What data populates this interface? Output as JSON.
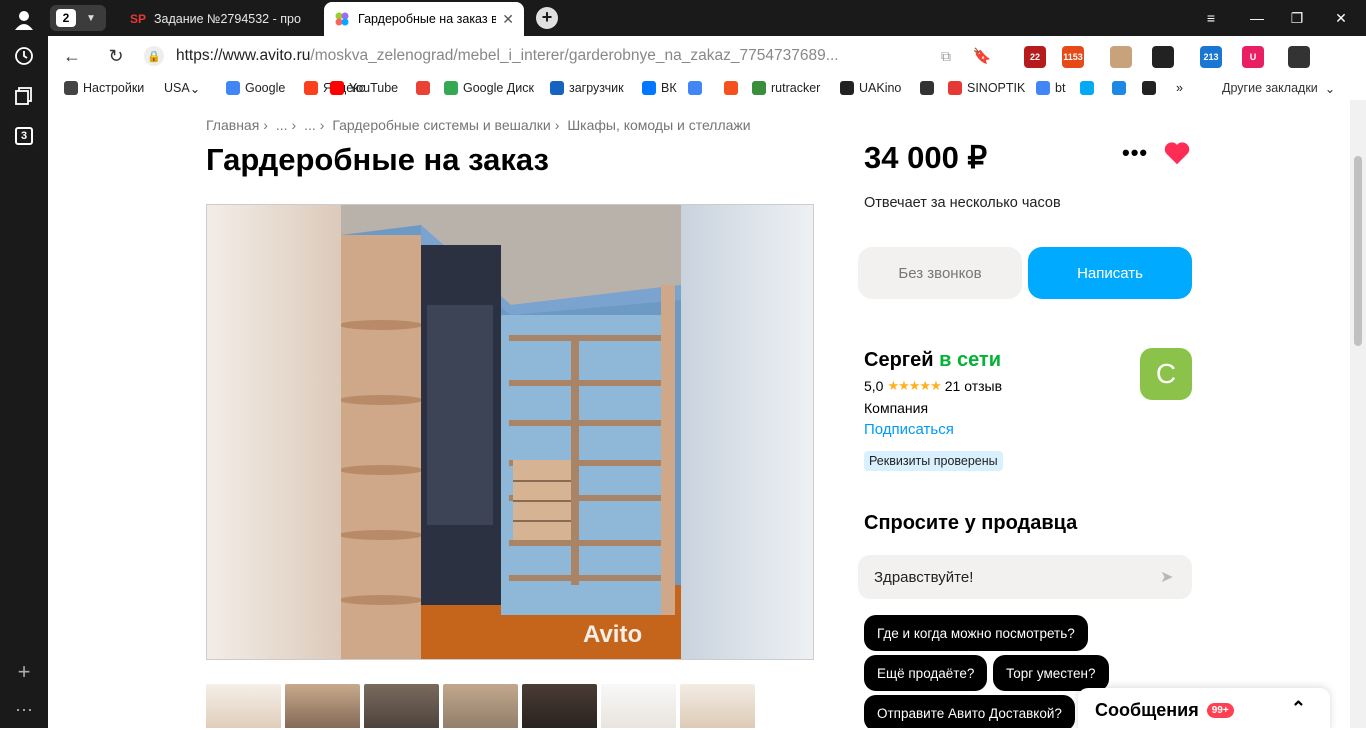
{
  "browser": {
    "tab_count": "2",
    "sidebar_badge": "3",
    "tabs": [
      {
        "favicon": "SP",
        "title": "Задание №2794532 - про"
      },
      {
        "favicon": "avito-icon",
        "title": "Гардеробные на заказ в"
      }
    ],
    "url_host": "https://www.avito.ru",
    "url_path": "/moskva_zelenograd/mebel_i_interer/garderobnye_na_zakaz_7754737689...",
    "extensions": [
      {
        "label": "22",
        "color": "#b71c1c"
      },
      {
        "label": "1153",
        "color": "#e64a19"
      },
      {
        "label": "",
        "color": "#c8a27a"
      },
      {
        "label": "",
        "color": "#222222"
      },
      {
        "label": "213",
        "color": "#1976d2"
      },
      {
        "label": "U",
        "color": "#e91e63"
      },
      {
        "label": "",
        "color": "#333333"
      }
    ],
    "bookmarks": [
      {
        "label": "Настройки",
        "icon": "gear-icon"
      },
      {
        "label": "USA",
        "icon": "dropdown"
      },
      {
        "label": "Google",
        "icon": "google-icon"
      },
      {
        "label": "Яндекс",
        "icon": "yandex-icon"
      },
      {
        "label": "YouTube",
        "icon": "youtube-icon"
      },
      {
        "label": "",
        "icon": "gmail-icon"
      },
      {
        "label": "Google Диск",
        "icon": "drive-icon"
      },
      {
        "label": "загрузчик",
        "icon": "loader-icon"
      },
      {
        "label": "ВК",
        "icon": "vk-icon"
      },
      {
        "label": "",
        "icon": "translate-icon"
      },
      {
        "label": "",
        "icon": "f-icon"
      },
      {
        "label": "rutracker",
        "icon": "rutracker-icon"
      },
      {
        "label": "UAKino",
        "icon": "uakino-icon"
      },
      {
        "label": "",
        "icon": "chess-icon"
      },
      {
        "label": "SINOPTIK",
        "icon": "sinoptik-icon"
      },
      {
        "label": "bt",
        "icon": "google-icon"
      },
      {
        "label": "",
        "icon": "p-icon"
      },
      {
        "label": "",
        "icon": "arrow-icon"
      },
      {
        "label": "",
        "icon": "bc-icon"
      },
      {
        "label": "»",
        "icon": ""
      }
    ],
    "other_bookmarks": "Другие закладки"
  },
  "listing": {
    "breadcrumbs": [
      "Главная",
      "...",
      "...",
      "Гардеробные системы и вешалки",
      "Шкафы, комоды и стеллажи"
    ],
    "title": "Гардеробные на заказ",
    "watermark": "Avito",
    "price": "34 000 ₽",
    "more": "•••",
    "response_time": "Отвечает за несколько часов",
    "btn_no_calls": "Без звонков",
    "btn_write": "Написать"
  },
  "seller": {
    "name": "Сергей",
    "status": "в сети",
    "rating": "5,0",
    "stars": "★★★★★",
    "reviews": "21 отзыв",
    "type": "Компания",
    "subscribe": "Подписаться",
    "verified": "Реквизиты проверены",
    "avatar_letter": "С"
  },
  "ask": {
    "title": "Спросите у продавца",
    "input_value": "Здравствуйте!",
    "chips": [
      "Где и когда можно посмотреть?",
      "Ещё продаёте?",
      "Торг уместен?",
      "Отправите Авито Доставкой?"
    ]
  },
  "messages": {
    "label": "Сообщения",
    "count": "99+"
  },
  "colors": {
    "accent_blue": "#00aaff",
    "online_green": "#02b336",
    "heart_red": "#ff2d55"
  }
}
